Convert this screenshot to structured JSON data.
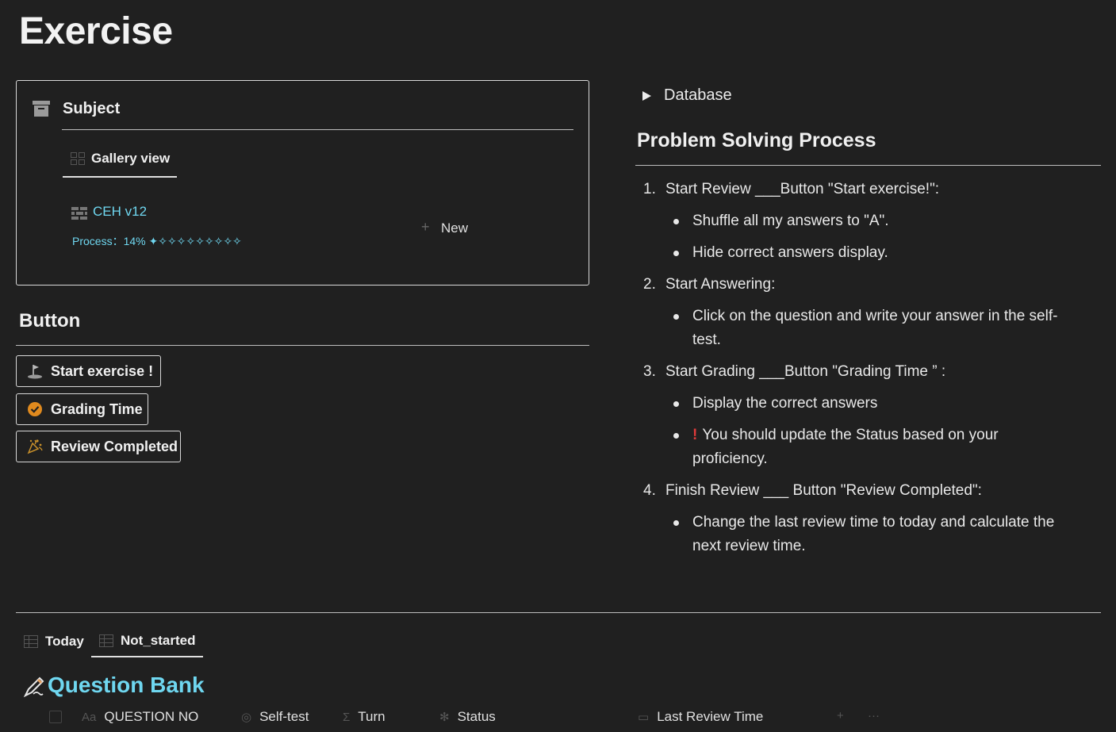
{
  "page": {
    "title": "Exercise"
  },
  "subject": {
    "title": "Subject",
    "icon": "archive-icon",
    "view_tab": "Gallery view",
    "card": {
      "title": "CEH v12",
      "process": "Process：14% ✦✧✧✧✧✧✧✧✧✧"
    },
    "new_label": "New",
    "new_plus": "+"
  },
  "buttons": {
    "heading": "Button",
    "start": "Start exercise !",
    "grading": "Grading Time",
    "review": "Review Completed"
  },
  "database": {
    "label": "Database"
  },
  "process": {
    "heading": "Problem Solving Process",
    "steps": [
      {
        "num": "1.",
        "text": "Start Review ___Button \"Start exercise!\":"
      },
      {
        "num": "2.",
        "text": "Start Answering:"
      },
      {
        "num": "3.",
        "text": "Start Grading ___Button \"Grading Time ” :"
      },
      {
        "num": "4.",
        "text": "Finish Review ___ Button \"Review Completed\":"
      }
    ],
    "bullets": [
      "Shuffle all my answers to \"A\".",
      "Hide correct answers display.",
      "Click on the question and write your answer in the self-test.",
      "Display the correct answers",
      "You should update the Status based on your proficiency.",
      "Change the last review time to today and calculate the next review time."
    ],
    "warn_glyph": "!"
  },
  "bottom": {
    "tabs": [
      "Today",
      "Not_started"
    ],
    "title": "Question Bank",
    "columns": [
      {
        "icon": "Aa",
        "label": "QUESTION NO"
      },
      {
        "icon": "◎",
        "label": "Self-test"
      },
      {
        "icon": "Σ",
        "label": "Turn"
      },
      {
        "icon": "✻",
        "label": "Status"
      },
      {
        "icon": "▭",
        "label": "Last Review Time"
      }
    ],
    "add": "+",
    "more": "···"
  },
  "colors": {
    "accent": "#6fd7f0",
    "background": "#202020",
    "warn": "#e03a3a",
    "check": "#e08a1e"
  }
}
